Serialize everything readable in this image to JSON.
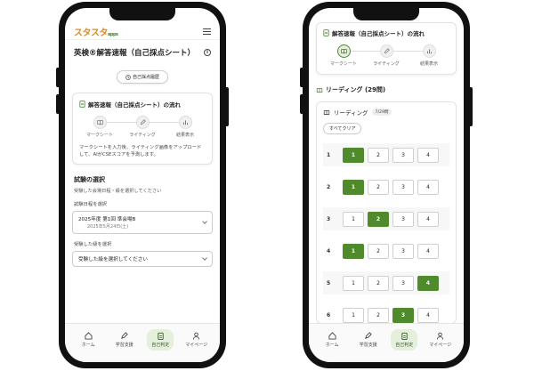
{
  "phone1": {
    "logo": "スタスタ",
    "logo_sub": "apps",
    "page_title": "英検®解答速報（自己採点シート）",
    "history_button": "自己採点履歴",
    "flow_card": {
      "title": "解答速報（自己採点シート）の流れ",
      "steps": [
        "マークシート",
        "ライティング",
        "結果表示"
      ],
      "description": "マークシートを入力後、ライティング画像をアップロードして、AIがCSEスコアを予測します。"
    },
    "exam_section": {
      "title": "試験の選択",
      "subtitle": "受験した会場日程・級を選択してください",
      "date_label": "試験日程を選択",
      "date_value": "2025年度 第1回 準会場B",
      "date_sub": "2025年5月24日(土)",
      "grade_label": "受験した級を選択",
      "grade_value": "受験した級を選択してください"
    }
  },
  "phone2": {
    "flow_title": "解答速報（自己採点シート）の流れ",
    "steps": [
      "マークシート",
      "ライティング",
      "結果表示"
    ],
    "section_title": "リーディング (29問)",
    "reading_label": "リーディング",
    "progress_badge": "7/29問",
    "clear_button": "すべてクリア",
    "questions": [
      {
        "num": "1",
        "selected": 1
      },
      {
        "num": "2",
        "selected": 1
      },
      {
        "num": "3",
        "selected": 2
      },
      {
        "num": "4",
        "selected": 1
      },
      {
        "num": "5",
        "selected": 4
      },
      {
        "num": "6",
        "selected": 3
      },
      {
        "num": "7",
        "selected": 3
      }
    ],
    "options": [
      "1",
      "2",
      "3",
      "4"
    ]
  },
  "tabbar": [
    "ホーム",
    "学習支援",
    "自己判定",
    "マイページ"
  ],
  "colors": {
    "accent": "#4f8a2c",
    "logo": "#e08a18"
  }
}
